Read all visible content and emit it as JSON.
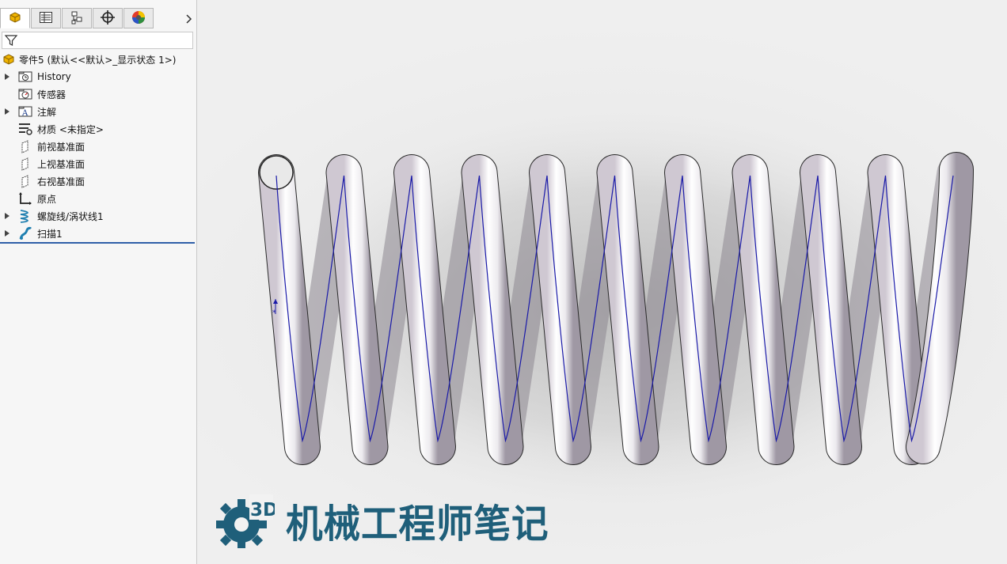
{
  "tabs": [
    {
      "name": "featuremanager-tab",
      "icon": "part-icon",
      "active": true
    },
    {
      "name": "propertymanager-tab",
      "icon": "property-list-icon",
      "active": false
    },
    {
      "name": "configurationmanager-tab",
      "icon": "configuration-icon",
      "active": false
    },
    {
      "name": "dimxpert-tab",
      "icon": "crosshair-icon",
      "active": false
    },
    {
      "name": "display-manager-tab",
      "icon": "color-wheel-icon",
      "active": false
    }
  ],
  "filter": {
    "icon": "filter-icon"
  },
  "tree": {
    "root": {
      "label": "零件5  (默认<<默认>_显示状态 1>)",
      "icon": "part-icon"
    },
    "items": [
      {
        "label": "History",
        "icon": "history-folder-icon",
        "expandable": true
      },
      {
        "label": "传感器",
        "icon": "sensor-folder-icon",
        "expandable": false
      },
      {
        "label": "注解",
        "icon": "annotation-folder-icon",
        "expandable": true
      },
      {
        "label": "材质 <未指定>",
        "icon": "material-icon",
        "expandable": false
      },
      {
        "label": "前视基准面",
        "icon": "plane-icon",
        "expandable": false
      },
      {
        "label": "上视基准面",
        "icon": "plane-icon",
        "expandable": false
      },
      {
        "label": "右视基准面",
        "icon": "plane-icon",
        "expandable": false
      },
      {
        "label": "原点",
        "icon": "origin-icon",
        "expandable": false
      },
      {
        "label": "螺旋线/涡状线1",
        "icon": "helix-icon",
        "expandable": true
      },
      {
        "label": "扫描1",
        "icon": "sweep-icon",
        "expandable": true
      }
    ]
  },
  "model": {
    "name": "spring",
    "coils": 10,
    "helix_color": "#1a1aa8"
  },
  "watermark": {
    "badge": "3D",
    "text": "机械工程师笔记",
    "color": "#1f5f7a"
  },
  "colors": {
    "accent": "#2f5fa8",
    "panel_bg": "#f6f6f6",
    "viewport_bg": "#ececec"
  }
}
